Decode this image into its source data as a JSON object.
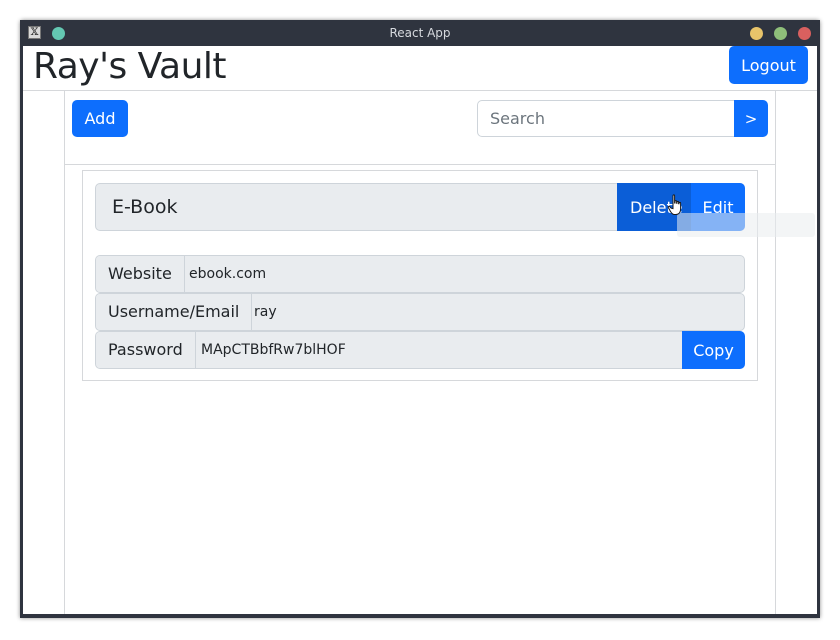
{
  "window": {
    "title": "React App",
    "app_icon_glyph": "𝕏"
  },
  "header": {
    "app_title": "Ray's Vault",
    "logout_label": "Logout"
  },
  "toolbar": {
    "add_label": "Add",
    "search_placeholder": "Search",
    "search_value": "",
    "search_button_label": ">"
  },
  "entry": {
    "name": "E-Book",
    "delete_label": "Delete",
    "edit_label": "Edit",
    "fields": [
      {
        "label": "Website",
        "value": "ebook.com"
      },
      {
        "label": "Username/Email",
        "value": "ray"
      },
      {
        "label": "Password",
        "value": "MApCTBbfRw7blHOF"
      }
    ],
    "copy_label": "Copy"
  },
  "colors": {
    "primary": "#0d6efd",
    "primary_active": "#0b5ed7",
    "titlebar": "#2f343f",
    "input_group_bg": "#e9ecef"
  },
  "icons": {
    "cursor": "hand-pointer-icon"
  }
}
